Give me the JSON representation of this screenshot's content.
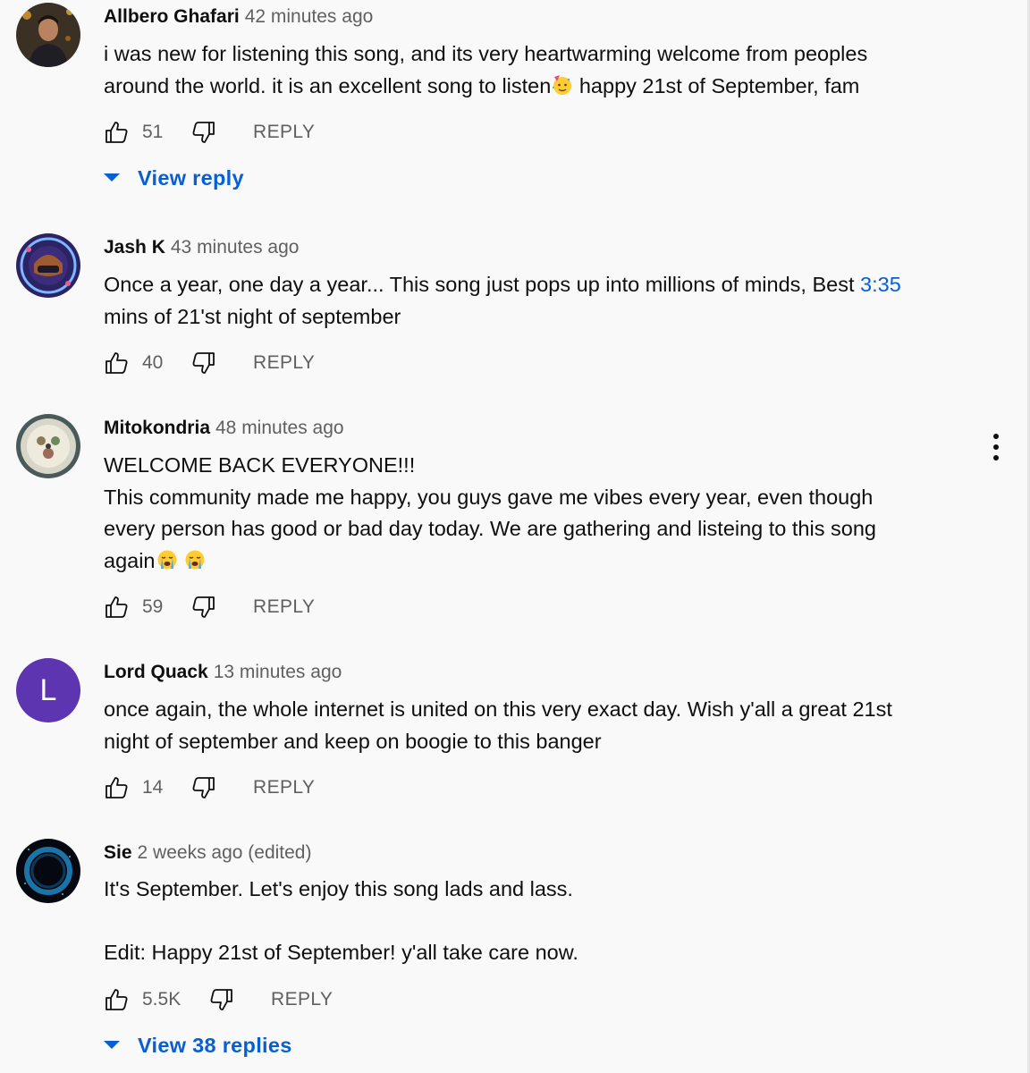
{
  "comments": [
    {
      "author": "Allbero Ghafari",
      "time": "42 minutes ago",
      "text_line1": "i was new for listening this song, and its very heartwarming welcome from peoples",
      "text_line2a": "around the world. it is an excellent song to listen",
      "emoji": "partying-face",
      "text_line2b": " happy 21st of September, fam",
      "likes": "51",
      "reply_label": "REPLY",
      "view_replies": "View reply"
    },
    {
      "author": "Jash K",
      "time": "43 minutes ago",
      "text_line1a": "Once a year, one day a year... This song just pops up into millions of minds, Best ",
      "timestamp_link": "3:35",
      "text_line2": "mins of 21'st night of september",
      "likes": "40",
      "reply_label": "REPLY"
    },
    {
      "author": "Mitokondria",
      "time": "48 minutes ago",
      "text_line1": "WELCOME BACK EVERYONE!!!",
      "text_line2": "This community made me happy, you guys gave me vibes every year, even though",
      "text_line3": "every person has good or bad day today. We are gathering and listeing to this song",
      "text_line4": "again",
      "emoji": "loudly-crying-face",
      "likes": "59",
      "reply_label": "REPLY"
    },
    {
      "author": "Lord Quack",
      "time": "13 minutes ago",
      "avatar_letter": "L",
      "text_line1": "once again, the whole internet is united on this very exact day. Wish y'all a great 21st",
      "text_line2": "night of september and keep on boogie to this banger",
      "likes": "14",
      "reply_label": "REPLY"
    },
    {
      "author": "Sie",
      "time": "2 weeks ago (edited)",
      "text_line1": "It's September. Let's enjoy this song lads and lass.",
      "text_line3": "Edit: Happy 21st of September! y'all take care now.",
      "likes": "5.5K",
      "reply_label": "REPLY",
      "view_replies": "View 38 replies"
    }
  ],
  "colors": {
    "background": "#f9f9f9",
    "link_blue": "#065fd4",
    "secondary_text": "#606060",
    "avatar_purple": "#5e35b1"
  }
}
